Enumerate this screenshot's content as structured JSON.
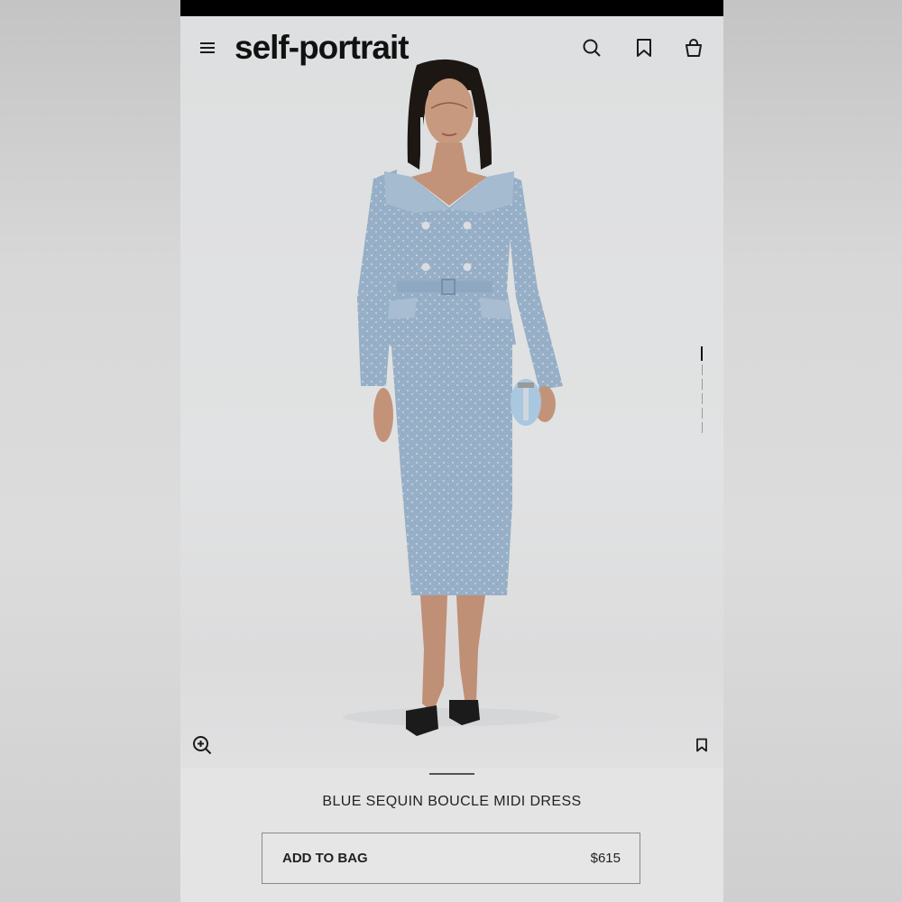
{
  "header": {
    "logo": "self-portrait",
    "icons": [
      "hamburger-menu-icon",
      "search-icon",
      "bookmark-icon",
      "shopping-bag-icon"
    ]
  },
  "gallery": {
    "image_subject": "model-in-blue-sequin-boucle-suit",
    "page_indicator": {
      "total": 6,
      "current": 1
    },
    "icons": [
      "zoom-in-icon",
      "bookmark-icon"
    ]
  },
  "product": {
    "title": "BLUE SEQUIN BOUCLE MIDI DRESS",
    "add_to_bag_label": "ADD TO BAG",
    "price": "$615"
  },
  "colors": {
    "status_bar": "#000000",
    "background": "#e3e3e4",
    "garment": "#98b0c8",
    "text": "#111111"
  }
}
